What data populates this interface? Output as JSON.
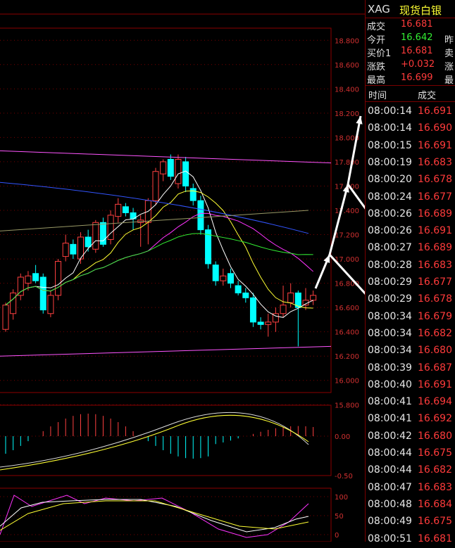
{
  "header": {
    "symbol": "XAG",
    "name": "现货白银"
  },
  "quote": [
    {
      "label": "成交",
      "value": "16.681",
      "color": "red",
      "right": ""
    },
    {
      "label": "今开",
      "value": "16.642",
      "color": "green",
      "right": "昨"
    },
    {
      "label": "买价1",
      "value": "16.681",
      "color": "red",
      "right": "卖"
    },
    {
      "label": "涨跌",
      "value": "+0.032",
      "color": "red",
      "right": "涨"
    },
    {
      "label": "最高",
      "value": "16.699",
      "color": "red",
      "right": "最"
    }
  ],
  "ticks_header": {
    "time": "时间",
    "price": "成交"
  },
  "ticks": [
    {
      "time": "08:00:14",
      "price": "16.691"
    },
    {
      "time": "08:00:14",
      "price": "16.690"
    },
    {
      "time": "08:00:15",
      "price": "16.691"
    },
    {
      "time": "08:00:19",
      "price": "16.683"
    },
    {
      "time": "08:00:20",
      "price": "16.678"
    },
    {
      "time": "08:00:24",
      "price": "16.677"
    },
    {
      "time": "08:00:26",
      "price": "16.689"
    },
    {
      "time": "08:00:26",
      "price": "16.691"
    },
    {
      "time": "08:00:27",
      "price": "16.689"
    },
    {
      "time": "08:00:28",
      "price": "16.683"
    },
    {
      "time": "08:00:29",
      "price": "16.677"
    },
    {
      "time": "08:00:29",
      "price": "16.678"
    },
    {
      "time": "08:00:34",
      "price": "16.679"
    },
    {
      "time": "08:00:34",
      "price": "16.682"
    },
    {
      "time": "08:00:34",
      "price": "16.680"
    },
    {
      "time": "08:00:39",
      "price": "16.687"
    },
    {
      "time": "08:00:40",
      "price": "16.691"
    },
    {
      "time": "08:00:41",
      "price": "16.694"
    },
    {
      "time": "08:00:41",
      "price": "16.692"
    },
    {
      "time": "08:00:42",
      "price": "16.680"
    },
    {
      "time": "08:00:44",
      "price": "16.675"
    },
    {
      "time": "08:00:44",
      "price": "16.682"
    },
    {
      "time": "08:00:47",
      "price": "16.683"
    },
    {
      "time": "08:00:48",
      "price": "16.684"
    },
    {
      "time": "08:00:49",
      "price": "16.675"
    },
    {
      "time": "08:00:51",
      "price": "16.681"
    }
  ],
  "chart_data": {
    "type": "candlestick",
    "price_axis": {
      "min": 15.9,
      "max": 18.9,
      "ticks": [
        "18.800",
        "18.600",
        "18.400",
        "18.200",
        "18.000",
        "17.800",
        "17.600",
        "17.400",
        "17.200",
        "17.000",
        "16.800",
        "16.600",
        "16.400",
        "16.200",
        "16.000",
        "15.800"
      ]
    },
    "macd_axis": {
      "ticks": [
        "0.00",
        "-0.50"
      ]
    },
    "osc_axis": {
      "ticks": [
        "100",
        "50",
        "0"
      ]
    },
    "candles": [
      [
        16.42,
        16.62,
        16.4,
        16.64
      ],
      [
        16.55,
        16.72,
        16.5,
        16.75
      ],
      [
        16.7,
        16.85,
        16.66,
        16.88
      ],
      [
        16.8,
        16.86,
        16.74,
        16.9
      ],
      [
        16.88,
        16.82,
        16.8,
        16.95
      ],
      [
        16.85,
        16.58,
        16.55,
        16.88
      ],
      [
        16.55,
        16.7,
        16.52,
        16.74
      ],
      [
        16.7,
        16.98,
        16.66,
        17.0
      ],
      [
        17.02,
        17.13,
        16.98,
        17.2
      ],
      [
        17.12,
        17.04,
        17.0,
        17.16
      ],
      [
        17.0,
        17.18,
        16.96,
        17.22
      ],
      [
        17.18,
        17.1,
        17.06,
        17.24
      ],
      [
        17.08,
        17.3,
        17.05,
        17.32
      ],
      [
        17.3,
        17.12,
        17.1,
        17.34
      ],
      [
        17.16,
        17.36,
        17.12,
        17.4
      ],
      [
        17.35,
        17.45,
        17.3,
        17.5
      ],
      [
        17.43,
        17.38,
        17.35,
        17.46
      ],
      [
        17.38,
        17.33,
        17.24,
        17.42
      ],
      [
        17.3,
        17.32,
        17.1,
        17.36
      ],
      [
        17.3,
        17.48,
        17.12,
        17.5
      ],
      [
        17.48,
        17.72,
        17.45,
        17.75
      ],
      [
        17.7,
        17.8,
        17.64,
        17.82
      ],
      [
        17.82,
        17.68,
        17.65,
        17.86
      ],
      [
        17.62,
        17.82,
        17.58,
        17.86
      ],
      [
        17.8,
        17.6,
        17.55,
        17.84
      ],
      [
        17.58,
        17.48,
        17.44,
        17.62
      ],
      [
        17.48,
        17.24,
        17.2,
        17.52
      ],
      [
        17.24,
        16.96,
        16.92,
        17.28
      ],
      [
        16.95,
        16.82,
        16.78,
        16.98
      ],
      [
        16.82,
        16.86,
        16.78,
        16.92
      ],
      [
        16.88,
        16.8,
        16.76,
        16.92
      ],
      [
        16.78,
        16.72,
        16.7,
        16.82
      ],
      [
        16.72,
        16.68,
        16.64,
        16.76
      ],
      [
        16.68,
        16.48,
        16.44,
        16.72
      ],
      [
        16.48,
        16.46,
        16.42,
        16.52
      ],
      [
        16.46,
        16.48,
        16.36,
        16.55
      ],
      [
        16.48,
        16.55,
        16.4,
        16.6
      ],
      [
        16.55,
        16.62,
        16.52,
        16.78
      ],
      [
        16.64,
        16.72,
        16.6,
        16.8
      ],
      [
        16.72,
        16.6,
        16.28,
        16.74
      ],
      [
        16.62,
        16.66,
        16.58,
        16.76
      ],
      [
        16.66,
        16.7,
        16.62,
        16.74
      ]
    ]
  }
}
